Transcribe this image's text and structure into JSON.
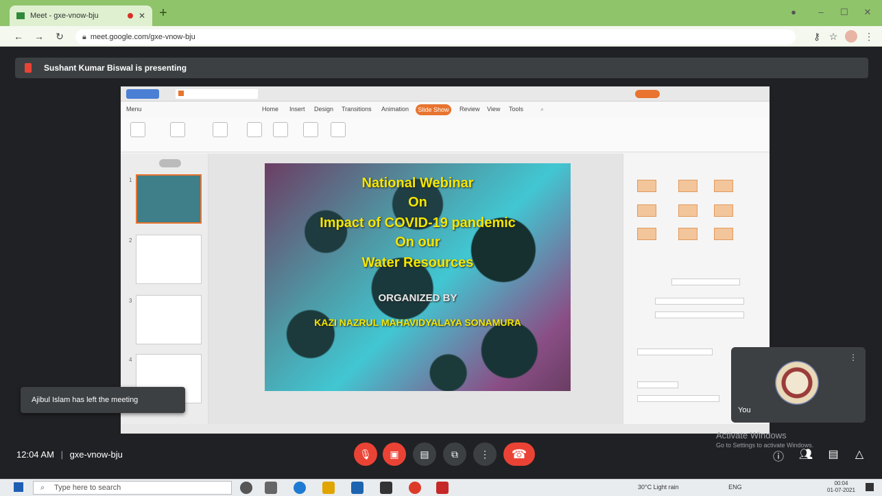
{
  "browser": {
    "tab_title": "Meet - gxe-vnow-bju",
    "address": "meet.google.com/gxe-vnow-bju",
    "icons": [
      "back-icon",
      "forward-icon",
      "reload-icon",
      "lock-icon",
      "key-icon",
      "star-icon",
      "profile-icon",
      "menu-icon"
    ]
  },
  "meet": {
    "presenting_banner": "Sushant Kumar Biswal is presenting",
    "notification": "Ajibul Islam has left the meeting",
    "self_label": "You",
    "meeting_time": "12:04 AM",
    "meeting_separator": "|",
    "meeting_code": "gxe-vnow-bju",
    "activate_line1": "Activate Windows",
    "activate_line2": "Go to Settings to activate Windows."
  },
  "presentation": {
    "ribbon_tabs": [
      "Menu",
      "Home",
      "Insert",
      "Design",
      "Transitions",
      "Animation",
      "Slide Show",
      "Review",
      "View",
      "Tools"
    ],
    "active_tab": "Slide Show",
    "slide": {
      "line1": "National Webinar",
      "line2": "On",
      "line3": "Impact of COVID-19 pandemic",
      "line4": "On our",
      "line5": "Water Resources",
      "line6": "ORGANIZED BY",
      "line7": "KAZI NAZRUL MAHAVIDYALAYA SONAMURA"
    }
  },
  "taskbar": {
    "search_placeholder": "Type here to search",
    "weather": "30°C Light rain",
    "lang": "ENG",
    "time": "00:04",
    "date": "01-07-2021"
  },
  "colors": {
    "accent": "#e8742f",
    "meet_red": "#ea4335",
    "slide_text": "#f4e600",
    "chrome_green": "#8fc46b"
  }
}
